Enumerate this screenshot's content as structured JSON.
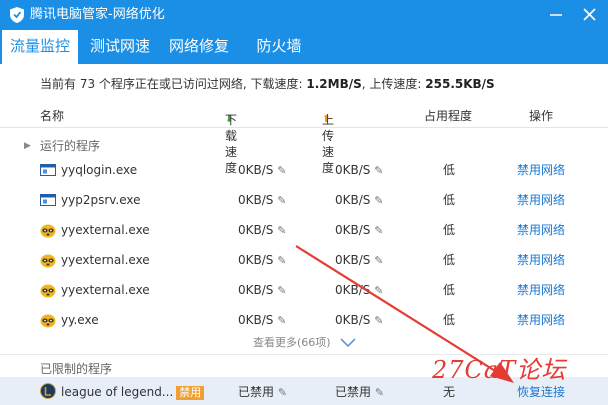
{
  "window": {
    "title": "腾讯电脑管家-网络优化"
  },
  "tabs": [
    "流量监控",
    "测试网速",
    "网络修复",
    "防火墙"
  ],
  "summary": {
    "prefix": "当前有 73 个程序正在或已访问过网络, 下载速度: ",
    "download": "1.2MB/S",
    "mid": ", 上传速度: ",
    "upload": "255.5KB/S"
  },
  "columns": {
    "name": "名称",
    "download": "下载速度",
    "upload": "上传速度",
    "level": "占用程度",
    "action": "操作"
  },
  "running": {
    "label": "运行的程序",
    "rows": [
      {
        "name": "yyqlogin.exe",
        "icon": "window-icon",
        "dl": "0KB/S",
        "ul": "0KB/S",
        "level": "低",
        "action": "禁用网络"
      },
      {
        "name": "yyp2psrv.exe",
        "icon": "window-icon",
        "dl": "0KB/S",
        "ul": "0KB/S",
        "level": "低",
        "action": "禁用网络"
      },
      {
        "name": "yyexternal.exe",
        "icon": "raccoon-icon",
        "dl": "0KB/S",
        "ul": "0KB/S",
        "level": "低",
        "action": "禁用网络"
      },
      {
        "name": "yyexternal.exe",
        "icon": "raccoon-icon",
        "dl": "0KB/S",
        "ul": "0KB/S",
        "level": "低",
        "action": "禁用网络"
      },
      {
        "name": "yyexternal.exe",
        "icon": "raccoon-icon",
        "dl": "0KB/S",
        "ul": "0KB/S",
        "level": "低",
        "action": "禁用网络"
      },
      {
        "name": "yy.exe",
        "icon": "raccoon-icon",
        "dl": "0KB/S",
        "ul": "0KB/S",
        "level": "低",
        "action": "禁用网络"
      }
    ],
    "more": "查看更多(66项)"
  },
  "limited": {
    "label": "已限制的程序",
    "rows": [
      {
        "name": "league of legend...",
        "badge": "禁用",
        "dl": "已禁用",
        "ul": "已禁用",
        "level": "无",
        "action": "恢复连接"
      }
    ]
  },
  "watermark": "27CaT论坛",
  "colors": {
    "accent": "#1b8fe6",
    "link": "#1b78d0",
    "annotation": "#e43b33"
  }
}
